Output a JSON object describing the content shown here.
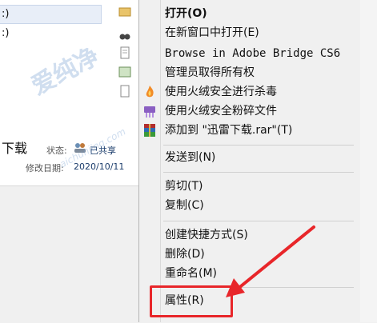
{
  "tree": {
    "items": [
      {
        "label": ":)"
      },
      {
        "label": ":)"
      }
    ]
  },
  "details": {
    "title_fragment": "下载",
    "status_label": "状态:",
    "status_value": "已共享",
    "modified_label": "修改日期:",
    "modified_value": "2020/10/11"
  },
  "watermark": {
    "text": "爱纯净",
    "sub": "aichunjing.com"
  },
  "context_menu": {
    "items": [
      {
        "label": "打开(O)",
        "bold": true
      },
      {
        "label": "在新窗口中打开(E)"
      },
      {
        "label": "Browse in Adobe Bridge CS6"
      },
      {
        "label": "管理员取得所有权"
      },
      {
        "label": "使用火绒安全进行杀毒",
        "icon": "huorong-flame-icon"
      },
      {
        "label": "使用火绒安全粉碎文件",
        "icon": "shredder-icon"
      },
      {
        "label": "添加到 \"迅雷下载.rar\"(T)",
        "icon": "winrar-icon"
      },
      {
        "label": "发送到(N)"
      },
      {
        "label": "剪切(T)"
      },
      {
        "label": "复制(C)"
      },
      {
        "label": "创建快捷方式(S)"
      },
      {
        "label": "删除(D)"
      },
      {
        "label": "重命名(M)"
      },
      {
        "label": "属性(R)"
      }
    ]
  },
  "annotation": {
    "color": "#e8262a"
  }
}
